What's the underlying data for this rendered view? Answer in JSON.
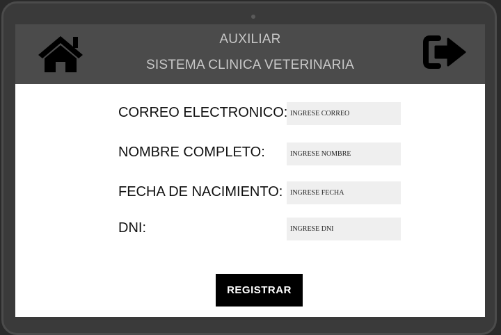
{
  "header": {
    "role_title": "AUXILIAR",
    "system_title": "SISTEMA CLINICA VETERINARIA",
    "home_icon": "home-icon",
    "logout_icon": "logout-icon"
  },
  "form": {
    "email": {
      "label": "CORREO ELECTRONICO:",
      "placeholder": "INGRESE CORREO"
    },
    "name": {
      "label": "NOMBRE COMPLETO:",
      "placeholder": "INGRESE NOMBRE"
    },
    "birthdate": {
      "label": "FECHA DE NACIMIENTO:",
      "placeholder": "INGRESE FECHA"
    },
    "dni": {
      "label": "DNI:",
      "placeholder": "INGRESE DNI"
    },
    "submit_label": "REGISTRAR"
  },
  "colors": {
    "header_bg": "#4b4b4b",
    "header_text": "#c8c8c8",
    "input_bg": "#efefef",
    "button_bg": "#000000"
  }
}
